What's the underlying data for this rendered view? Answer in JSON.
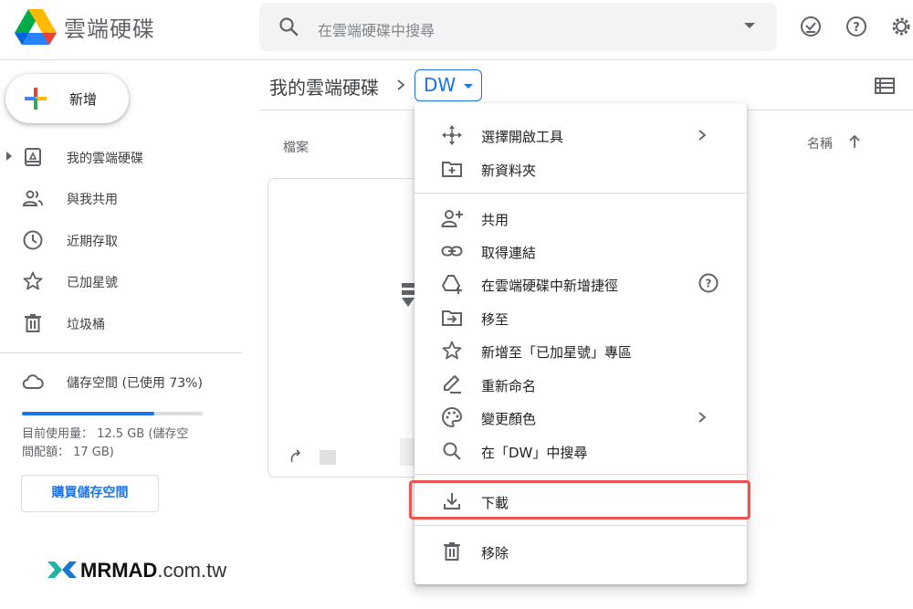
{
  "header": {
    "app_title": "雲端硬碟",
    "search_placeholder": "在雲端硬碟中搜尋",
    "icons": [
      "drive-logo",
      "search-icon",
      "dropdown-icon",
      "offline-check-icon",
      "help-icon",
      "settings-icon"
    ]
  },
  "sidebar": {
    "new_label": "新增",
    "items": [
      {
        "label": "我的雲端硬碟",
        "icon": "my-drive-icon"
      },
      {
        "label": "與我共用",
        "icon": "shared-icon"
      },
      {
        "label": "近期存取",
        "icon": "clock-icon"
      },
      {
        "label": "已加星號",
        "icon": "star-icon"
      },
      {
        "label": "垃圾桶",
        "icon": "trash-icon"
      }
    ],
    "storage": {
      "label": "儲存空間 (已使用 73%)",
      "used_fraction": 0.73,
      "detail_line1": "目前使用量： 12.5 GB (儲存空",
      "detail_line2": "間配額： 17 GB)",
      "buy_label": "購買儲存空間"
    },
    "brand": {
      "name": "MRMAD",
      "domain": ".com.tw"
    }
  },
  "main": {
    "breadcrumb_root": "我的雲端硬碟",
    "breadcrumb_current": "DW",
    "files_heading": "檔案",
    "sort_label": "名稱"
  },
  "context_menu": {
    "items": [
      {
        "label": "選擇開啟工具",
        "icon": "open-with-icon",
        "submenu": true
      },
      {
        "label": "新資料夾",
        "icon": "new-folder-icon"
      },
      {
        "label": "共用",
        "icon": "share-icon"
      },
      {
        "label": "取得連結",
        "icon": "link-icon"
      },
      {
        "label": "在雲端硬碟中新增捷徑",
        "icon": "add-shortcut-icon",
        "help": true
      },
      {
        "label": "移至",
        "icon": "move-icon"
      },
      {
        "label": "新增至「已加星號」專區",
        "icon": "star-icon"
      },
      {
        "label": "重新命名",
        "icon": "rename-icon"
      },
      {
        "label": "變更顏色",
        "icon": "palette-icon",
        "submenu": true
      },
      {
        "label": "在「DW」中搜尋",
        "icon": "search-icon"
      },
      {
        "label": "下載",
        "icon": "download-icon",
        "highlighted": true
      },
      {
        "label": "移除",
        "icon": "trash-icon"
      }
    ]
  },
  "colors": {
    "accent": "#1a73e8",
    "highlight": "#ef5350",
    "text": "#3c4043"
  }
}
